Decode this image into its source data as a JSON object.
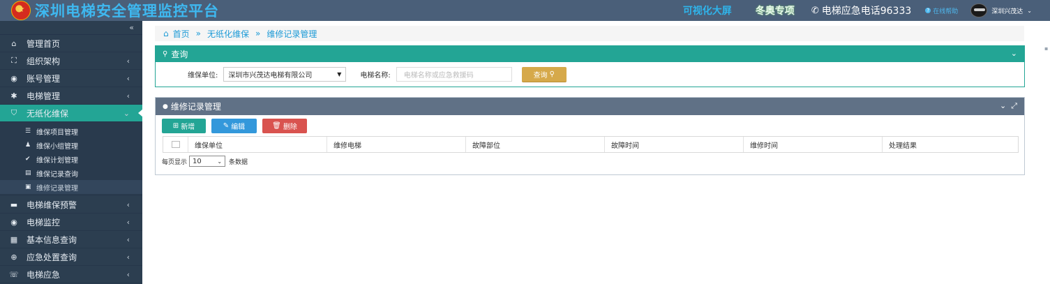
{
  "header": {
    "title": "深圳电梯安全管理监控平台",
    "links": {
      "big_screen": "可视化大屏",
      "winter_olympics": "冬奥专项",
      "hotline": "电梯应急电话96333",
      "help": "在线帮助",
      "user": "深圳兴茂达"
    }
  },
  "sidebar": {
    "collapse_glyph": "«",
    "items": [
      {
        "label": "管理首页",
        "icon": "home-icon",
        "glyph": "⌂",
        "arrow": ""
      },
      {
        "label": "组织架构",
        "icon": "sitemap-icon",
        "glyph": "⛶",
        "arrow": "‹"
      },
      {
        "label": "账号管理",
        "icon": "user-circle-icon",
        "glyph": "◉",
        "arrow": "‹"
      },
      {
        "label": "电梯管理",
        "icon": "gear-icon",
        "glyph": "✱",
        "arrow": "‹"
      },
      {
        "label": "无纸化维保",
        "icon": "shield-icon",
        "glyph": "⛉",
        "arrow": "⌄"
      }
    ],
    "sub_items": [
      {
        "label": "维保项目管理",
        "icon": "list-icon",
        "glyph": "☰"
      },
      {
        "label": "维保小组管理",
        "icon": "group-icon",
        "glyph": "♟"
      },
      {
        "label": "维保计划管理",
        "icon": "check-circle-icon",
        "glyph": "✔"
      },
      {
        "label": "维保记录查询",
        "icon": "keyboard-icon",
        "glyph": "▤"
      },
      {
        "label": "维修记录管理",
        "icon": "camera-icon",
        "glyph": "▣"
      }
    ],
    "items_after": [
      {
        "label": "电梯维保预警",
        "icon": "briefcase-icon",
        "glyph": "▬",
        "arrow": "‹"
      },
      {
        "label": "电梯监控",
        "icon": "eye-icon",
        "glyph": "◉",
        "arrow": "‹"
      },
      {
        "label": "基本信息查询",
        "icon": "table-icon",
        "glyph": "▦",
        "arrow": "‹"
      },
      {
        "label": "应急处置查询",
        "icon": "lifebuoy-icon",
        "glyph": "⊕",
        "arrow": "‹"
      },
      {
        "label": "电梯应急",
        "icon": "phone-volume-icon",
        "glyph": "☏",
        "arrow": "‹"
      }
    ]
  },
  "breadcrumb": {
    "home": "首页",
    "level2": "无纸化维保",
    "level3": "维修记录管理",
    "sep": "»"
  },
  "search_panel": {
    "title": "查询",
    "unit_label": "维保单位:",
    "unit_value": "深圳市兴茂达电梯有限公司",
    "elevator_label": "电梯名称:",
    "elevator_placeholder": "电梯名称或应急救援码",
    "query_button": "查询"
  },
  "records_panel": {
    "title": "维修记录管理",
    "buttons": {
      "add": "新增",
      "edit": "编辑",
      "delete": "删除"
    },
    "columns": [
      "维保单位",
      "维修电梯",
      "故障部位",
      "故障时间",
      "维修时间",
      "处理结果"
    ],
    "pager": {
      "prefix": "每页显示",
      "page_size": "10",
      "suffix": "条数据"
    }
  },
  "colors": {
    "header_bg": "#4a5f79",
    "sidebar_bg": "#2c3e50",
    "accent_green": "#23a595",
    "query_button": "#d6a94a",
    "edit_button": "#3398db",
    "delete_button": "#d9534f"
  }
}
